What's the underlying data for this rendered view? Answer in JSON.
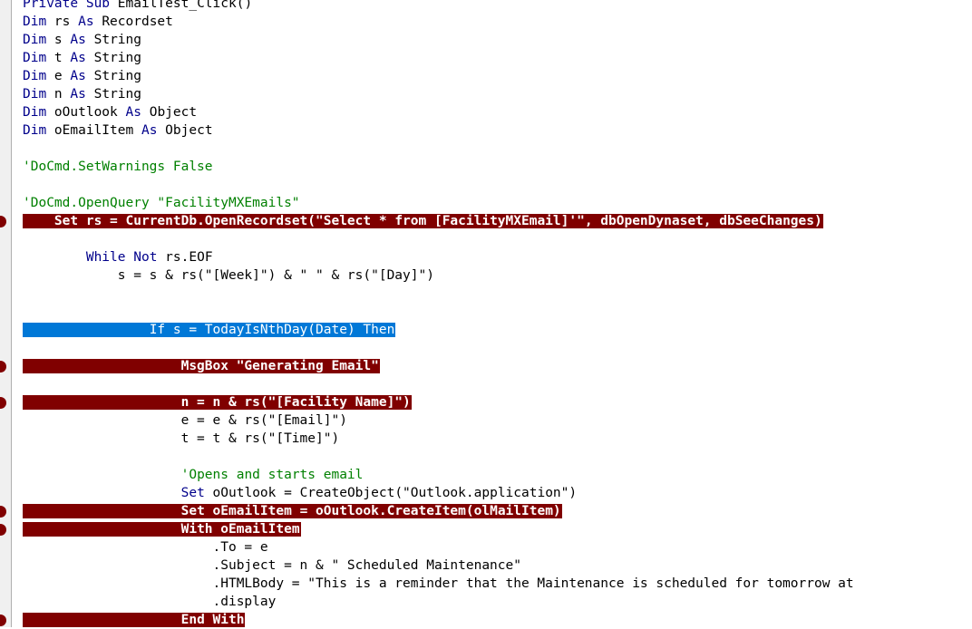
{
  "editor": {
    "lines": [
      {
        "indent": 0,
        "text": "Private Sub EmailTest_Click()"
      },
      {
        "indent": 0,
        "text": "Dim rs As Recordset"
      },
      {
        "indent": 0,
        "text": "Dim s As String"
      },
      {
        "indent": 0,
        "text": "Dim t As String"
      },
      {
        "indent": 0,
        "text": "Dim e As String"
      },
      {
        "indent": 0,
        "text": "Dim n As String"
      },
      {
        "indent": 0,
        "text": "Dim oOutlook As Object"
      },
      {
        "indent": 0,
        "text": "Dim oEmailItem As Object"
      },
      {
        "indent": 0,
        "text": ""
      },
      {
        "indent": 0,
        "text": "'DoCmd.SetWarnings False"
      },
      {
        "indent": 0,
        "text": ""
      },
      {
        "indent": 0,
        "text": "'DoCmd.OpenQuery \"FacilityMXEmails\""
      },
      {
        "indent": 4,
        "text": "Set rs = CurrentDb.OpenRecordset(\"Select * from [FacilityMXEmail]'\", dbOpenDynaset, dbSeeChanges)",
        "breakpoint": true
      },
      {
        "indent": 0,
        "text": ""
      },
      {
        "indent": 8,
        "text": "While Not rs.EOF"
      },
      {
        "indent": 12,
        "text": "s = s & rs(\"[Week]\") & \" \" & rs(\"[Day]\")"
      },
      {
        "indent": 0,
        "text": ""
      },
      {
        "indent": 0,
        "text": ""
      },
      {
        "indent": 16,
        "text": "If s = TodayIsNthDay(Date) Then",
        "selected": true
      },
      {
        "indent": 0,
        "text": ""
      },
      {
        "indent": 20,
        "text": "MsgBox \"Generating Email\"",
        "breakpoint": true
      },
      {
        "indent": 0,
        "text": ""
      },
      {
        "indent": 20,
        "text": "n = n & rs(\"[Facility Name]\")",
        "breakpoint": true
      },
      {
        "indent": 20,
        "text": "e = e & rs(\"[Email]\")"
      },
      {
        "indent": 20,
        "text": "t = t & rs(\"[Time]\")"
      },
      {
        "indent": 0,
        "text": ""
      },
      {
        "indent": 20,
        "text": "'Opens and starts email"
      },
      {
        "indent": 20,
        "text": "Set oOutlook = CreateObject(\"Outlook.application\")"
      },
      {
        "indent": 20,
        "text": "Set oEmailItem = oOutlook.CreateItem(olMailItem)",
        "breakpoint": true
      },
      {
        "indent": 20,
        "text": "With oEmailItem",
        "breakpoint": true
      },
      {
        "indent": 24,
        "text": ".To = e"
      },
      {
        "indent": 24,
        "text": ".Subject = n & \" Scheduled Maintenance\""
      },
      {
        "indent": 24,
        "text": ".HTMLBody = \"This is a reminder that the Maintenance is scheduled for tomorrow at"
      },
      {
        "indent": 24,
        "text": ".display"
      },
      {
        "indent": 20,
        "text": "End With",
        "breakpoint": true
      }
    ],
    "colors": {
      "keyword": "#00008b",
      "comment": "#008000",
      "breakpoint": "#800000",
      "selection": "#0078d7"
    }
  }
}
